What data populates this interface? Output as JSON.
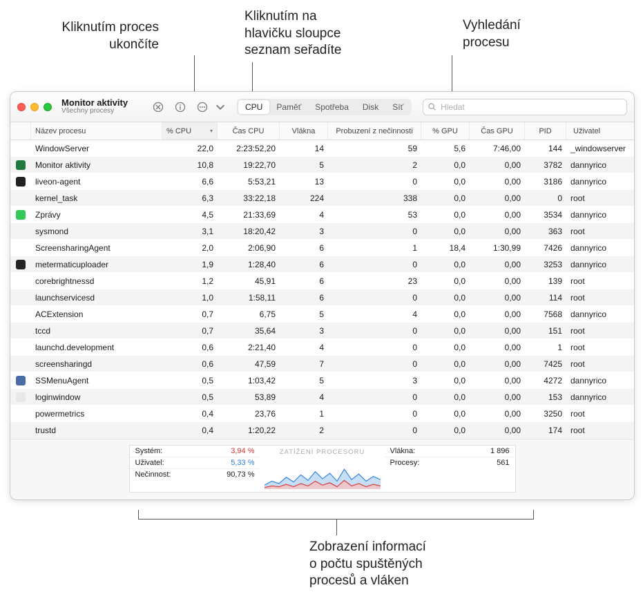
{
  "callouts": {
    "kill": "Kliknutím proces\nukončíte",
    "sort": "Kliknutím na\nhlavičku sloupce\nseznam seřadíte",
    "search": "Vyhledání\nprocesu",
    "bottom": "Zobrazení informací\no počtu spuštěných\nprocesů a vláken"
  },
  "window": {
    "title": "Monitor aktivity",
    "subtitle": "Všechny procesy"
  },
  "search": {
    "placeholder": "Hledat"
  },
  "tabs": [
    "CPU",
    "Paměť",
    "Spotřeba",
    "Disk",
    "Síť"
  ],
  "columns": {
    "name": "Název procesu",
    "cpu_pct": "% CPU",
    "cpu_time": "Čas CPU",
    "threads": "Vlákna",
    "idle_wake": "Probuzení z nečinnosti",
    "gpu_pct": "% GPU",
    "gpu_time": "Čas GPU",
    "pid": "PID",
    "user": "Uživatel"
  },
  "processes": [
    {
      "icon": null,
      "name": "WindowServer",
      "cpu_pct": "22,0",
      "cpu_time": "2:23:52,20",
      "threads": "14",
      "idle_wake": "59",
      "gpu_pct": "5,6",
      "gpu_time": "7:46,00",
      "pid": "144",
      "user": "_windowserver"
    },
    {
      "icon": "#1e7a3e",
      "name": "Monitor aktivity",
      "cpu_pct": "10,8",
      "cpu_time": "19:22,70",
      "threads": "5",
      "idle_wake": "2",
      "gpu_pct": "0,0",
      "gpu_time": "0,00",
      "pid": "3782",
      "user": "dannyrico"
    },
    {
      "icon": "#222",
      "name": "liveon-agent",
      "cpu_pct": "6,6",
      "cpu_time": "5:53,21",
      "threads": "13",
      "idle_wake": "0",
      "gpu_pct": "0,0",
      "gpu_time": "0,00",
      "pid": "3186",
      "user": "dannyrico"
    },
    {
      "icon": null,
      "name": "kernel_task",
      "cpu_pct": "6,3",
      "cpu_time": "33:22,18",
      "threads": "224",
      "idle_wake": "338",
      "gpu_pct": "0,0",
      "gpu_time": "0,00",
      "pid": "0",
      "user": "root"
    },
    {
      "icon": "#34c759",
      "name": "Zprávy",
      "cpu_pct": "4,5",
      "cpu_time": "21:33,69",
      "threads": "4",
      "idle_wake": "53",
      "gpu_pct": "0,0",
      "gpu_time": "0,00",
      "pid": "3534",
      "user": "dannyrico"
    },
    {
      "icon": null,
      "name": "sysmond",
      "cpu_pct": "3,1",
      "cpu_time": "18:20,42",
      "threads": "3",
      "idle_wake": "0",
      "gpu_pct": "0,0",
      "gpu_time": "0,00",
      "pid": "363",
      "user": "root"
    },
    {
      "icon": null,
      "name": "ScreensharingAgent",
      "cpu_pct": "2,0",
      "cpu_time": "2:06,90",
      "threads": "6",
      "idle_wake": "1",
      "gpu_pct": "18,4",
      "gpu_time": "1:30,99",
      "pid": "7426",
      "user": "dannyrico"
    },
    {
      "icon": "#222",
      "name": "metermaticuploader",
      "cpu_pct": "1,9",
      "cpu_time": "1:28,40",
      "threads": "6",
      "idle_wake": "0",
      "gpu_pct": "0,0",
      "gpu_time": "0,00",
      "pid": "3253",
      "user": "dannyrico"
    },
    {
      "icon": null,
      "name": "corebrightnessd",
      "cpu_pct": "1,2",
      "cpu_time": "45,91",
      "threads": "6",
      "idle_wake": "23",
      "gpu_pct": "0,0",
      "gpu_time": "0,00",
      "pid": "139",
      "user": "root"
    },
    {
      "icon": null,
      "name": "launchservicesd",
      "cpu_pct": "1,0",
      "cpu_time": "1:58,11",
      "threads": "6",
      "idle_wake": "0",
      "gpu_pct": "0,0",
      "gpu_time": "0,00",
      "pid": "114",
      "user": "root"
    },
    {
      "icon": null,
      "name": "ACExtension",
      "cpu_pct": "0,7",
      "cpu_time": "6,75",
      "threads": "5",
      "idle_wake": "4",
      "gpu_pct": "0,0",
      "gpu_time": "0,00",
      "pid": "7568",
      "user": "dannyrico"
    },
    {
      "icon": null,
      "name": "tccd",
      "cpu_pct": "0,7",
      "cpu_time": "35,64",
      "threads": "3",
      "idle_wake": "0",
      "gpu_pct": "0,0",
      "gpu_time": "0,00",
      "pid": "151",
      "user": "root"
    },
    {
      "icon": null,
      "name": "launchd.development",
      "cpu_pct": "0,6",
      "cpu_time": "2:21,40",
      "threads": "4",
      "idle_wake": "0",
      "gpu_pct": "0,0",
      "gpu_time": "0,00",
      "pid": "1",
      "user": "root"
    },
    {
      "icon": null,
      "name": "screensharingd",
      "cpu_pct": "0,6",
      "cpu_time": "47,59",
      "threads": "7",
      "idle_wake": "0",
      "gpu_pct": "0,0",
      "gpu_time": "0,00",
      "pid": "7425",
      "user": "root"
    },
    {
      "icon": "#4a6da7",
      "name": "SSMenuAgent",
      "cpu_pct": "0,5",
      "cpu_time": "1:03,42",
      "threads": "5",
      "idle_wake": "3",
      "gpu_pct": "0,0",
      "gpu_time": "0,00",
      "pid": "4272",
      "user": "dannyrico"
    },
    {
      "icon": "#e8e8e8",
      "name": "loginwindow",
      "cpu_pct": "0,5",
      "cpu_time": "53,89",
      "threads": "4",
      "idle_wake": "0",
      "gpu_pct": "0,0",
      "gpu_time": "0,00",
      "pid": "153",
      "user": "dannyrico"
    },
    {
      "icon": null,
      "name": "powermetrics",
      "cpu_pct": "0,4",
      "cpu_time": "23,76",
      "threads": "1",
      "idle_wake": "0",
      "gpu_pct": "0,0",
      "gpu_time": "0,00",
      "pid": "3250",
      "user": "root"
    },
    {
      "icon": null,
      "name": "trustd",
      "cpu_pct": "0,4",
      "cpu_time": "1:20,22",
      "threads": "2",
      "idle_wake": "0",
      "gpu_pct": "0,0",
      "gpu_time": "0,00",
      "pid": "174",
      "user": "root"
    }
  ],
  "summary": {
    "stats": [
      {
        "label": "Systém:",
        "value": "3,94 %",
        "color": "red"
      },
      {
        "label": "Uživatel:",
        "value": "5,33 %",
        "color": "blue"
      },
      {
        "label": "Nečinnost:",
        "value": "90,73 %",
        "color": ""
      }
    ],
    "chart_title": "ZATÍŽENÍ PROCESORU",
    "counts": [
      {
        "label": "Vlákna:",
        "value": "1 896"
      },
      {
        "label": "Procesy:",
        "value": "561"
      }
    ]
  }
}
